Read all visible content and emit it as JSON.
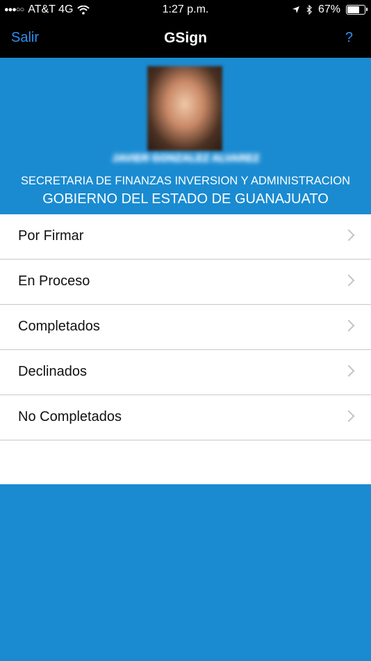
{
  "status_bar": {
    "carrier": "AT&T 4G",
    "time": "1:27 p.m.",
    "battery": "67%",
    "battery_level": 0.67
  },
  "nav": {
    "left": "Salir",
    "title": "GSign",
    "right": "?"
  },
  "profile": {
    "name": "JAVIER GONZALEZ ALVAREZ",
    "org_line1": "SECRETARIA DE FINANZAS INVERSION Y ADMINISTRACION",
    "org_line2": "GOBIERNO DEL ESTADO DE GUANAJUATO"
  },
  "menu": {
    "items": [
      {
        "label": "Por Firmar"
      },
      {
        "label": "En Proceso"
      },
      {
        "label": "Completados"
      },
      {
        "label": "Declinados"
      },
      {
        "label": "No Completados"
      }
    ]
  }
}
